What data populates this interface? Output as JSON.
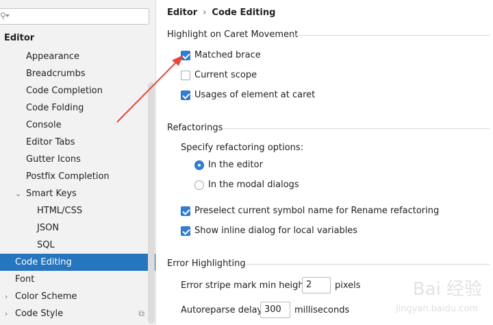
{
  "search": {
    "placeholder": ""
  },
  "sidebar": {
    "header": "Editor",
    "items": [
      {
        "label": "Appearance"
      },
      {
        "label": "Breadcrumbs"
      },
      {
        "label": "Code Completion"
      },
      {
        "label": "Code Folding"
      },
      {
        "label": "Console"
      },
      {
        "label": "Editor Tabs"
      },
      {
        "label": "Gutter Icons"
      },
      {
        "label": "Postfix Completion"
      },
      {
        "label": "Smart Keys",
        "expanded": true
      },
      {
        "label": "HTML/CSS"
      },
      {
        "label": "JSON"
      },
      {
        "label": "SQL"
      },
      {
        "label": "Code Editing",
        "selected": true
      },
      {
        "label": "Font"
      },
      {
        "label": "Color Scheme",
        "expandable": true
      },
      {
        "label": "Code Style",
        "expandable": true
      }
    ]
  },
  "breadcrumb": {
    "root": "Editor",
    "separator": "›",
    "current": "Code Editing"
  },
  "highlight": {
    "title": "Highlight on Caret Movement",
    "options": [
      {
        "label": "Matched brace",
        "checked": true
      },
      {
        "label": "Current scope",
        "checked": false
      },
      {
        "label": "Usages of element at caret",
        "checked": true
      }
    ]
  },
  "refactorings": {
    "title": "Refactorings",
    "specify_label": "Specify refactoring options:",
    "radios": [
      {
        "label": "In the editor",
        "selected": true
      },
      {
        "label": "In the modal dialogs",
        "selected": false
      }
    ],
    "options": [
      {
        "label": "Preselect current symbol name for Rename refactoring",
        "checked": true
      },
      {
        "label": "Show inline dialog for local variables",
        "checked": true
      }
    ]
  },
  "error_highlighting": {
    "title": "Error Highlighting",
    "stripe_label": "Error stripe mark min height:",
    "stripe_value": "2",
    "stripe_unit": "pixels",
    "autoreparse_label": "Autoreparse delay:",
    "autoreparse_value": "300",
    "autoreparse_unit": "milliseconds"
  },
  "watermark": {
    "text": "Bai 经验",
    "subtext": "jingyan.baidu.com"
  },
  "colors": {
    "accent": "#2675bf",
    "checkbox": "#2f7ed8",
    "arrow": "#e8463a"
  },
  "icons": {
    "search": "search-icon",
    "copy": "copy-icon",
    "chevron": "chevron-icon"
  }
}
